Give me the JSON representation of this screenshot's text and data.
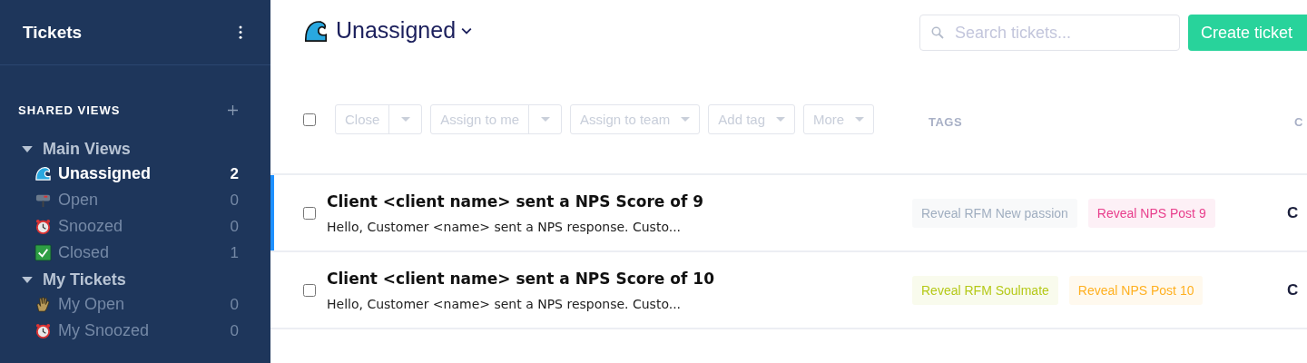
{
  "sidebar": {
    "title": "Tickets",
    "section": "SHARED VIEWS",
    "groups": [
      {
        "label": "Main Views",
        "expanded": true,
        "items": [
          {
            "label": "Unassigned",
            "count": "2",
            "kind": "wave",
            "selected": true
          },
          {
            "label": "Open",
            "count": "0",
            "kind": "mailbox",
            "selected": false
          },
          {
            "label": "Snoozed",
            "count": "0",
            "kind": "alarm",
            "selected": false
          },
          {
            "label": "Closed",
            "count": "1",
            "kind": "check",
            "selected": false
          }
        ]
      },
      {
        "label": "My Tickets",
        "expanded": true,
        "items": [
          {
            "label": "My Open",
            "count": "0",
            "kind": "hand",
            "selected": false
          },
          {
            "label": "My Snoozed",
            "count": "0",
            "kind": "alarm",
            "selected": false
          }
        ]
      }
    ]
  },
  "header": {
    "title": "Unassigned",
    "search": {
      "placeholder": "Search tickets..."
    },
    "create_button": "Create ticket"
  },
  "toolbar": {
    "checked": false,
    "actions": [
      {
        "label": "Close",
        "kind": "split"
      },
      {
        "label": "Assign to me",
        "kind": "split"
      },
      {
        "label": "Assign to team",
        "kind": "dropdown"
      },
      {
        "label": "Add tag",
        "kind": "dropdown"
      },
      {
        "label": "More",
        "kind": "dropdown"
      }
    ]
  },
  "table": {
    "columns": [
      "TAGS",
      "C"
    ],
    "rows": [
      {
        "selected": true,
        "checked": false,
        "title": "Client <client name> sent a NPS Score of 9",
        "preview": "Hello, Customer <name> sent a NPS response. Custo...",
        "tags": [
          {
            "label": "Reveal RFM New passion",
            "color": "#a0aec0"
          },
          {
            "label": "Reveal NPS Post 9",
            "color": "#e83e8c"
          }
        ],
        "column_3": "C"
      },
      {
        "selected": false,
        "checked": false,
        "title": "Client <client name> sent a NPS Score of 10",
        "preview": "Hello, Customer <name> sent a NPS response. Custo...",
        "tags": [
          {
            "label": "Reveal RFM Soulmate",
            "color": "#b5c918"
          },
          {
            "label": "Reveal NPS Post 10",
            "color": "#ffb020"
          }
        ],
        "column_3": "C"
      }
    ]
  }
}
